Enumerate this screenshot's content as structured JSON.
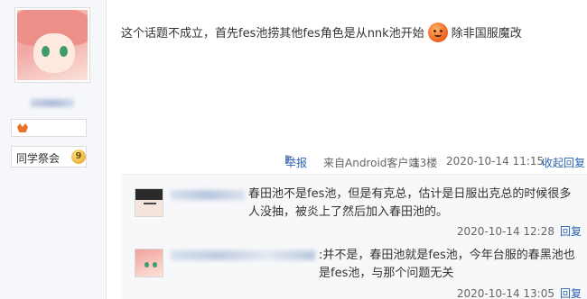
{
  "post": {
    "text_before_emoji": "这个话题不成立，首先fes池捞其他fes角色是从nnk池开始",
    "emoji": "laugh-emoji",
    "text_after_emoji": "除非国服魔改"
  },
  "author": {
    "level_name": "同学祭会",
    "level_num": "9"
  },
  "post_meta": {
    "report": "举报",
    "source": "来自Android客户端",
    "floor": "13楼",
    "time": "2020-10-14 11:15",
    "collapse": "收起回复"
  },
  "replies": [
    {
      "text": "春田池不是fes池，但是有克总，估计是日服出克总的时候很多人没抽，被炎上了然后加入春田池的。",
      "time": "2020-10-14 12:28",
      "reply_label": "回复"
    },
    {
      "text": ":并不是，春田池就是fes池，今年台服的春黑池也是fes池，与那个问题无关",
      "time": "2020-10-14 13:05",
      "reply_label": "回复"
    }
  ]
}
